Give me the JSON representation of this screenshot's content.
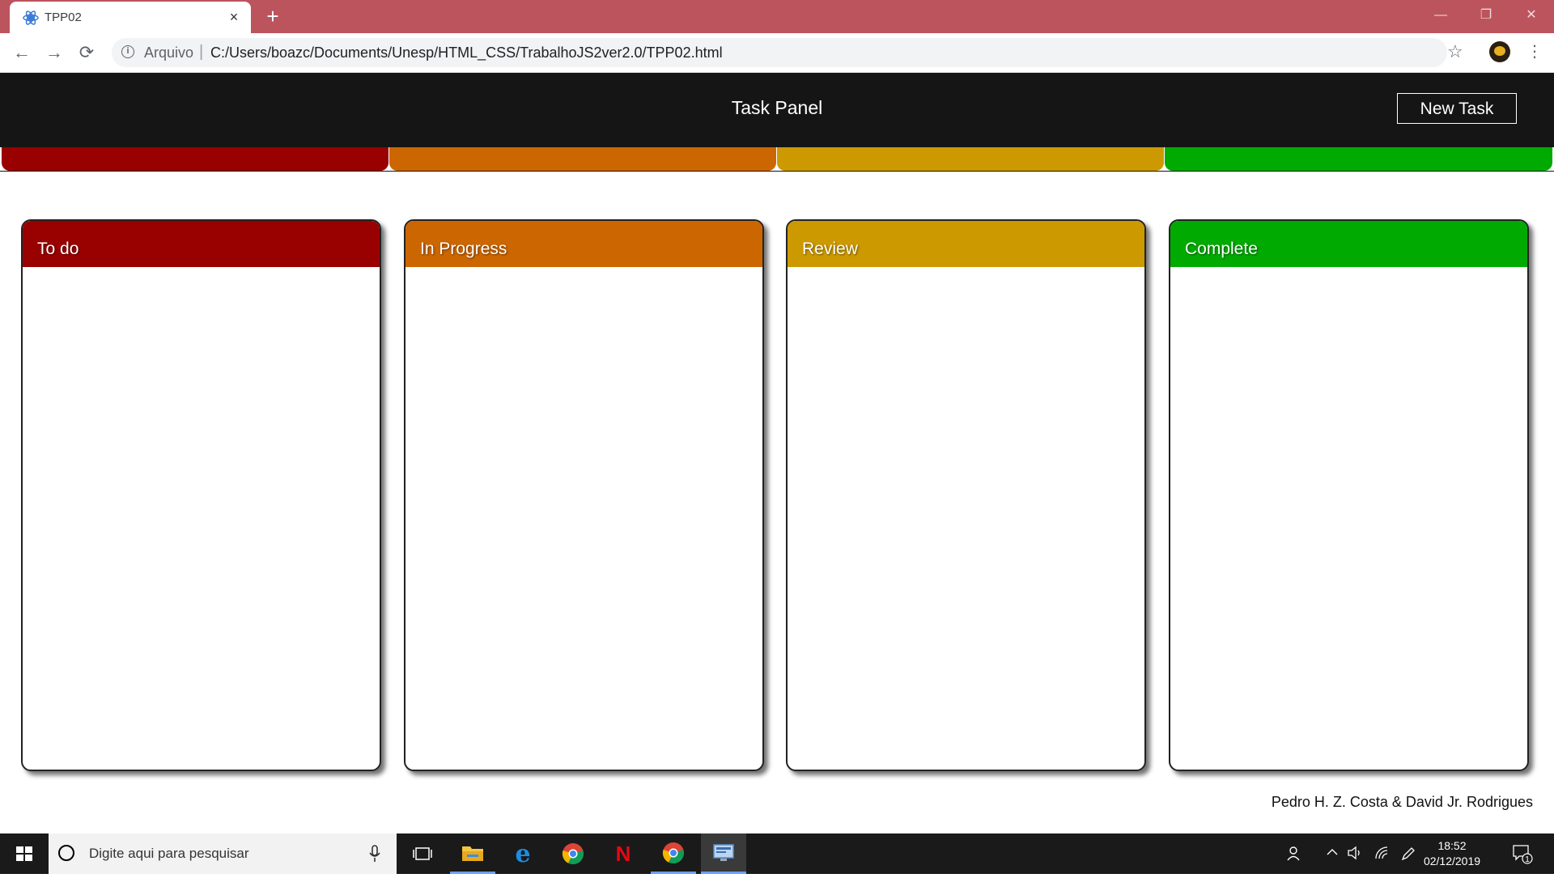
{
  "browser": {
    "tab_title": "TPP02",
    "tab_close": "×",
    "new_tab": "+",
    "url_scheme": "Arquivo",
    "url_separator": "|",
    "url": "C:/Users/boazc/Documents/Unesp/HTML_CSS/TrabalhoJS2ver2.0/TPP02.html",
    "window_controls": [
      "—",
      "❐",
      "✕"
    ],
    "nav": {
      "back": "←",
      "forward": "→",
      "reload": "⟳"
    },
    "star": "☆",
    "menu": "⋮",
    "info": "i"
  },
  "app": {
    "title": "Task Panel",
    "new_task_label": "New Task",
    "footer": "Pedro H. Z. Costa & David Jr. Rodrigues"
  },
  "columns": [
    {
      "title": "To do",
      "color": "#990000"
    },
    {
      "title": "In Progress",
      "color": "#cc6600"
    },
    {
      "title": "Review",
      "color": "#cc9900"
    },
    {
      "title": "Complete",
      "color": "#00aa00"
    }
  ],
  "taskbar": {
    "search_placeholder": "Digite aqui para pesquisar",
    "time": "18:52",
    "date": "02/12/2019",
    "notifications": "1"
  }
}
